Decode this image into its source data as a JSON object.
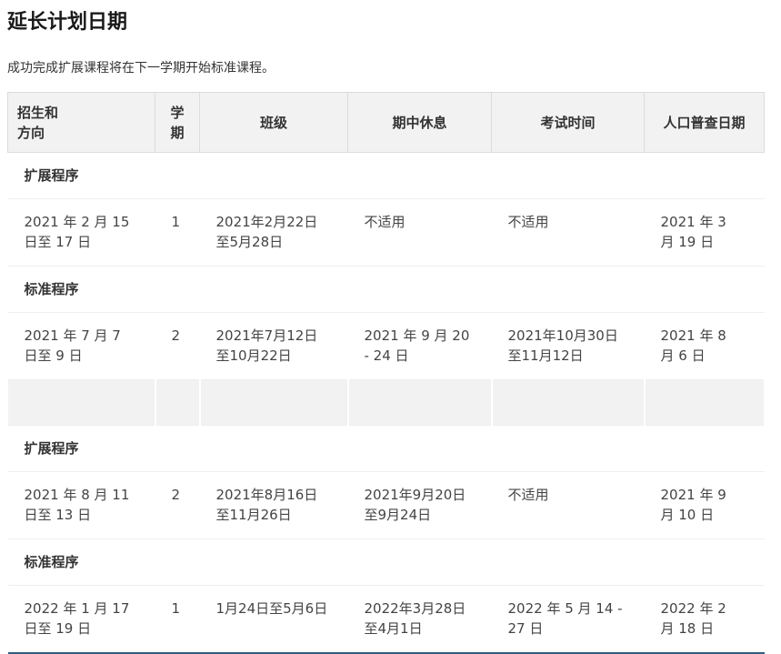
{
  "page": {
    "title": "延长计划日期",
    "intro": "成功完成扩展课程将在下一学期开始标准课程。"
  },
  "table": {
    "headers": {
      "enrollment": [
        "招生和",
        "方向"
      ],
      "term": [
        "学",
        "期"
      ],
      "classes": "班级",
      "mid_break": "期中休息",
      "exam_time": "考试时间",
      "census_date": "人口普查日期"
    },
    "groups": [
      {
        "section1": "扩展程序",
        "row1": {
          "enrollment": [
            "2021 年 2 月 15",
            "日至 17 日"
          ],
          "term": "1",
          "classes": [
            "2021年2月22日",
            "至5月28日"
          ],
          "mid_break": [
            "不适用"
          ],
          "exam_time": [
            "不适用"
          ],
          "census_date": [
            "2021 年 3",
            "月 19 日"
          ]
        },
        "section2": "标准程序",
        "row2": {
          "enrollment": [
            "2021 年 7 月 7",
            "日至 9 日"
          ],
          "term": "2",
          "classes": [
            "2021年7月12日",
            "至10月22日"
          ],
          "mid_break": [
            "2021 年 9 月 20",
            "- 24 日"
          ],
          "exam_time": [
            "2021年10月30日",
            "至11月12日"
          ],
          "census_date": [
            "2021 年 8",
            "月 6 日"
          ]
        }
      },
      {
        "section1": "扩展程序",
        "row1": {
          "enrollment": [
            "2021 年 8 月 11",
            "日至 13 日"
          ],
          "term": "2",
          "classes": [
            "2021年8月16日",
            "至11月26日"
          ],
          "mid_break": [
            "2021年9月20日",
            "至9月24日"
          ],
          "exam_time": [
            "不适用"
          ],
          "census_date": [
            "2021 年 9",
            "月 10 日"
          ]
        },
        "section2": "标准程序",
        "row2": {
          "enrollment": [
            "2022 年 1 月 17",
            "日至 19 日"
          ],
          "term": "1",
          "classes": [
            "1月24日至5月6日"
          ],
          "mid_break": [
            "2022年3月28日",
            "至4月1日"
          ],
          "exam_time": [
            "2022 年 5 月 14 -",
            "27 日"
          ],
          "census_date": [
            "2022 年 2",
            "月 18 日"
          ]
        }
      }
    ]
  }
}
